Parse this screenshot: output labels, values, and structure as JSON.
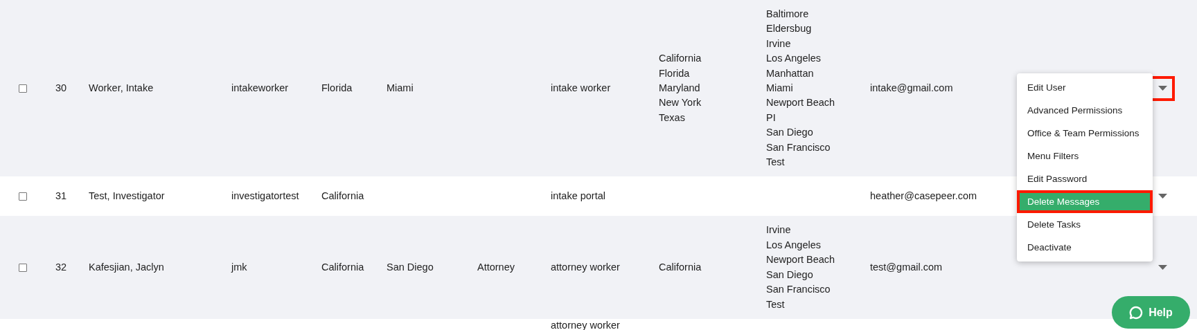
{
  "rows": [
    {
      "checked": false,
      "id": "30",
      "name": "Worker, Intake",
      "username": "intakeworker",
      "state": "Florida",
      "city": "Miami",
      "role": "intake worker",
      "states": [
        "California",
        "Florida",
        "Maryland",
        "New York",
        "Texas"
      ],
      "cities": [
        "Baltimore",
        "Eldersbug",
        "Irvine",
        "Los Angeles",
        "Manhattan",
        "Miami",
        "Newport Beach",
        "PI",
        "San Diego",
        "San Francisco",
        "Test"
      ],
      "email": "intake@gmail.com",
      "caret_outlined": true
    },
    {
      "checked": false,
      "id": "31",
      "name": "Test, Investigator",
      "username": "investigatortest",
      "state": "California",
      "role": "intake portal",
      "email": "heather@casepeer.com",
      "caret_outlined": false
    },
    {
      "checked": false,
      "id": "32",
      "name": "Kafesjian, Jaclyn",
      "username": "jmk",
      "state": "California",
      "city": "San Diego",
      "title": "Attorney",
      "role": "attorney worker",
      "states": [
        "California"
      ],
      "cities": [
        "Irvine",
        "Los Angeles",
        "Newport Beach",
        "San Diego",
        "San Francisco",
        "Test"
      ],
      "email": "test@gmail.com",
      "caret_outlined": false
    },
    {
      "role": "attorney worker"
    }
  ],
  "menu": {
    "items": [
      {
        "label": "Edit User",
        "selected": false,
        "outlined": false
      },
      {
        "label": "Advanced Permissions",
        "selected": false,
        "outlined": false
      },
      {
        "label": "Office & Team Permissions",
        "selected": false,
        "outlined": false
      },
      {
        "label": "Menu Filters",
        "selected": false,
        "outlined": false
      },
      {
        "label": "Edit Password",
        "selected": false,
        "outlined": false
      },
      {
        "label": "Delete Messages",
        "selected": true,
        "outlined": true
      },
      {
        "label": "Delete Tasks",
        "selected": false,
        "outlined": false
      },
      {
        "label": "Deactivate",
        "selected": false,
        "outlined": false
      }
    ]
  },
  "help_button": {
    "label": "Help"
  }
}
